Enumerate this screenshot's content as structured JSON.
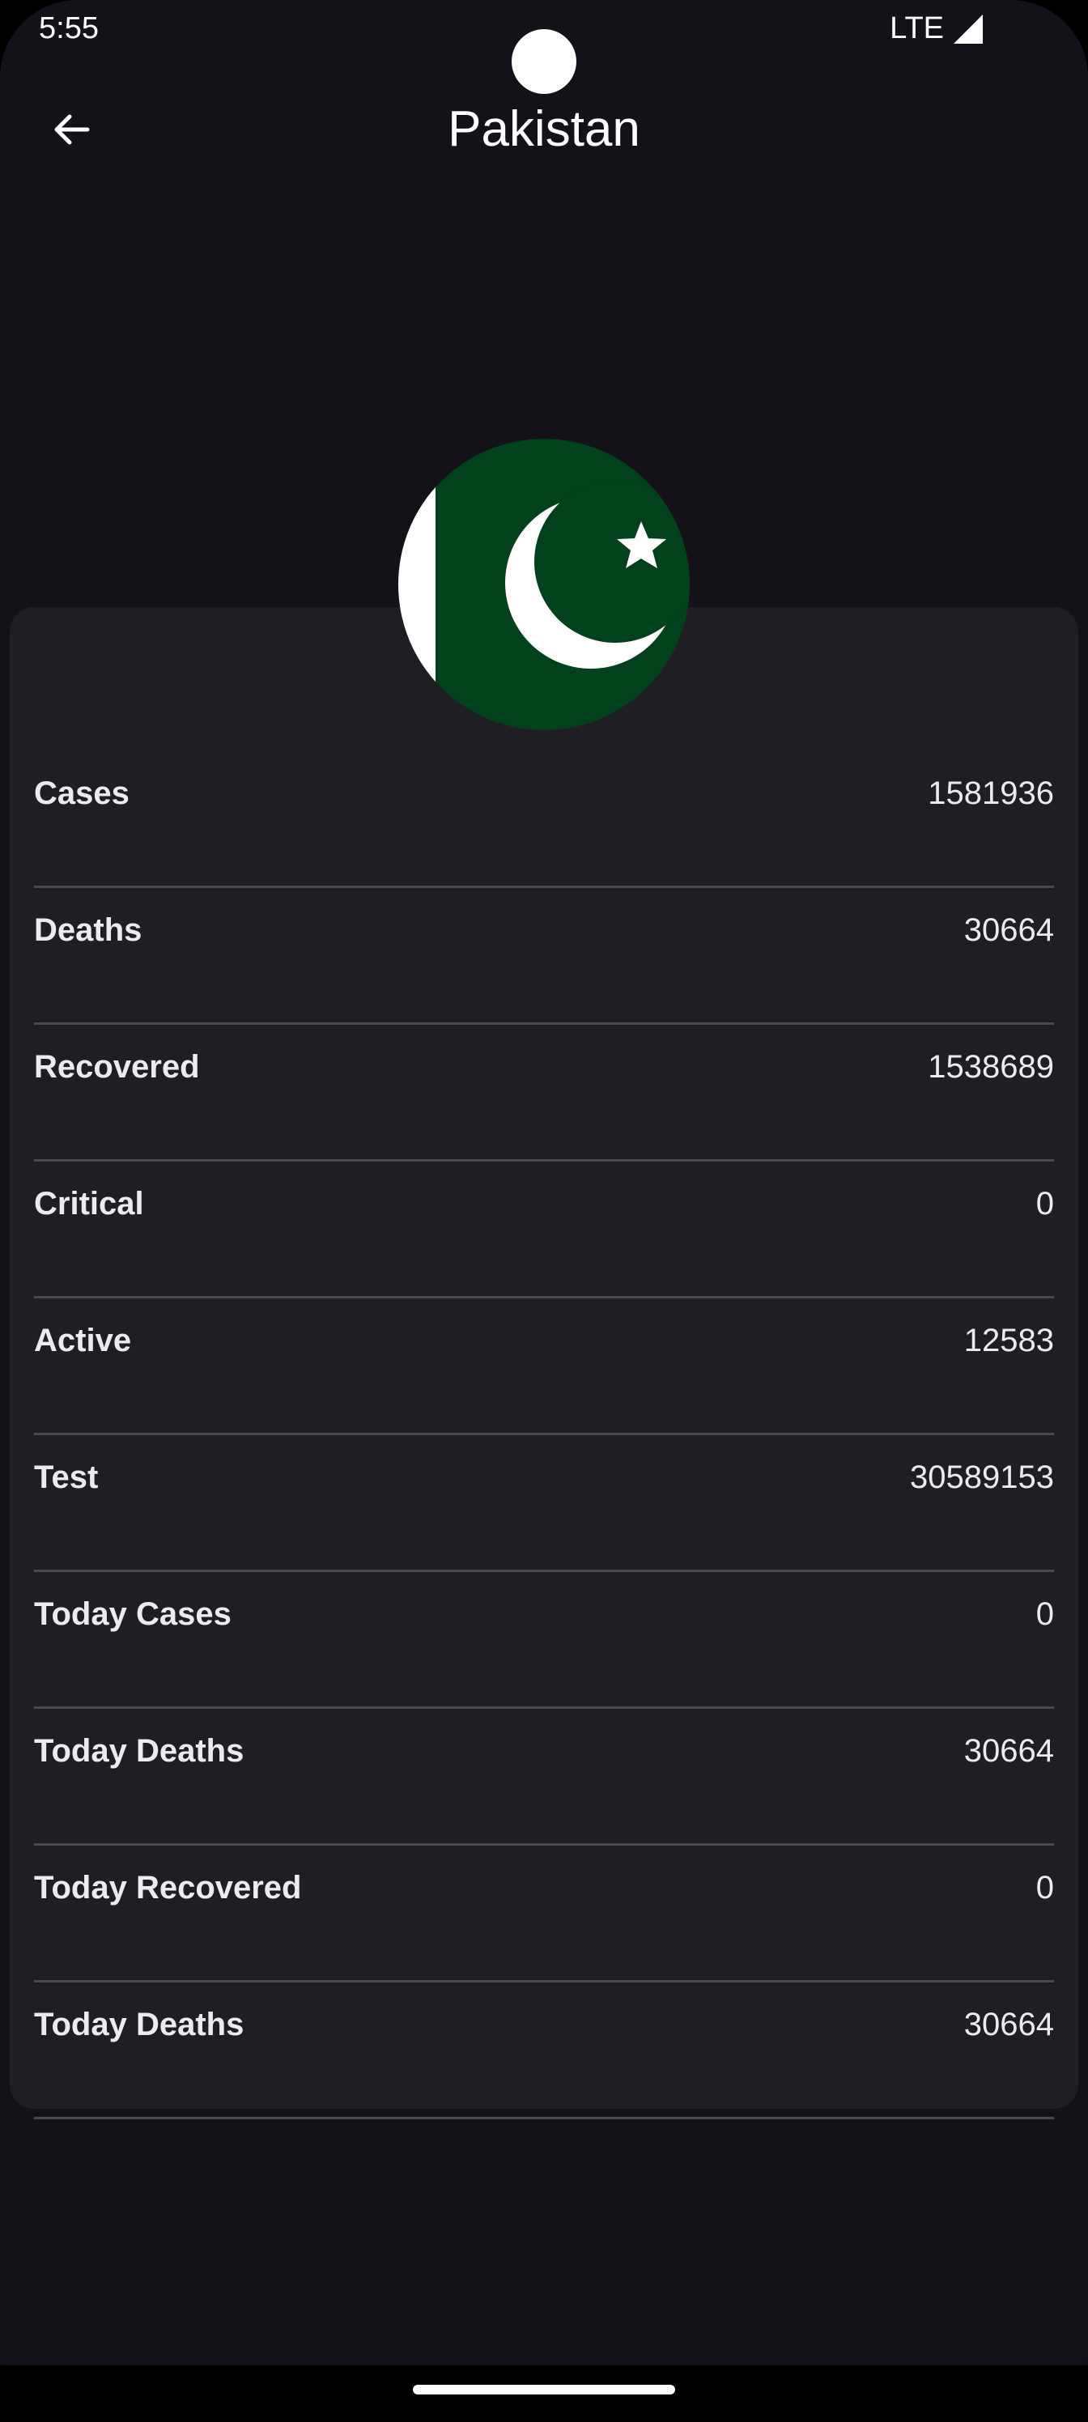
{
  "status_bar": {
    "time": "5:55",
    "network": "LTE",
    "signal_icon": "signal-icon"
  },
  "app_bar": {
    "back_icon": "arrow-back-icon",
    "title": "Pakistan"
  },
  "flag": {
    "country": "Pakistan",
    "colors": {
      "green": "#01411c",
      "white": "#ffffff"
    }
  },
  "stats": [
    {
      "label": "Cases",
      "value": "1581936"
    },
    {
      "label": "Deaths",
      "value": "30664"
    },
    {
      "label": "Recovered",
      "value": "1538689"
    },
    {
      "label": "Critical",
      "value": "0"
    },
    {
      "label": "Active",
      "value": "12583"
    },
    {
      "label": "Test",
      "value": "30589153"
    },
    {
      "label": "Today Cases",
      "value": "0"
    },
    {
      "label": "Today Deaths",
      "value": "30664"
    },
    {
      "label": "Today Recovered",
      "value": "0"
    },
    {
      "label": "Today Deaths",
      "value": "30664"
    }
  ],
  "theme": {
    "background": "#141218",
    "card": "#1f1e23",
    "text": "#ecebef",
    "divider": "#4a4950"
  }
}
